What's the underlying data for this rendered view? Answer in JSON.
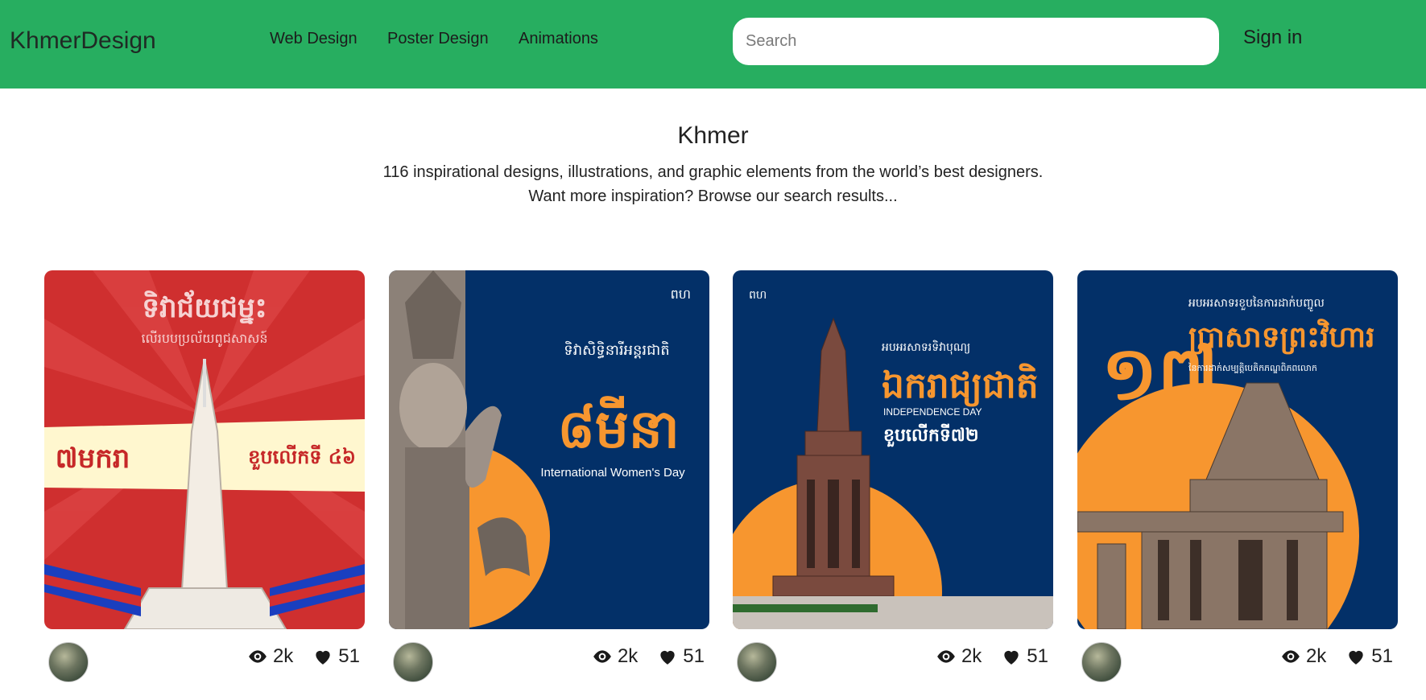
{
  "nav": {
    "brand": "KhmerDesign",
    "links": [
      "Web Design",
      "Poster Design",
      "Animations"
    ],
    "search_placeholder": "Search",
    "signin": "Sign in"
  },
  "hero": {
    "title": "Khmer",
    "line1": "116 inspirational designs, illustrations, and graphic elements from the world’s best designers.",
    "line2": "Want more inspiration? Browse our search results..."
  },
  "cards": [
    {
      "views": "2k",
      "likes": "51",
      "poster_text": "៧មករា",
      "poster_sub": "ខួបលើកទី ៤៦"
    },
    {
      "views": "2k",
      "likes": "51",
      "poster_text": "៨មីនា",
      "poster_sub": "International Women's Day"
    },
    {
      "views": "2k",
      "likes": "51",
      "poster_text": "ឯករាជ្យជាតិ",
      "poster_sub": "INDEPENDENCE DAY"
    },
    {
      "views": "2k",
      "likes": "51",
      "poster_text": "១៧",
      "poster_sub": "ប្រាសាទព្រះវិហារ"
    }
  ],
  "colors": {
    "nav_bg": "#27ae60",
    "poster_red": "#cf2f2f",
    "poster_navy": "#033068",
    "poster_orange": "#f7962f"
  }
}
